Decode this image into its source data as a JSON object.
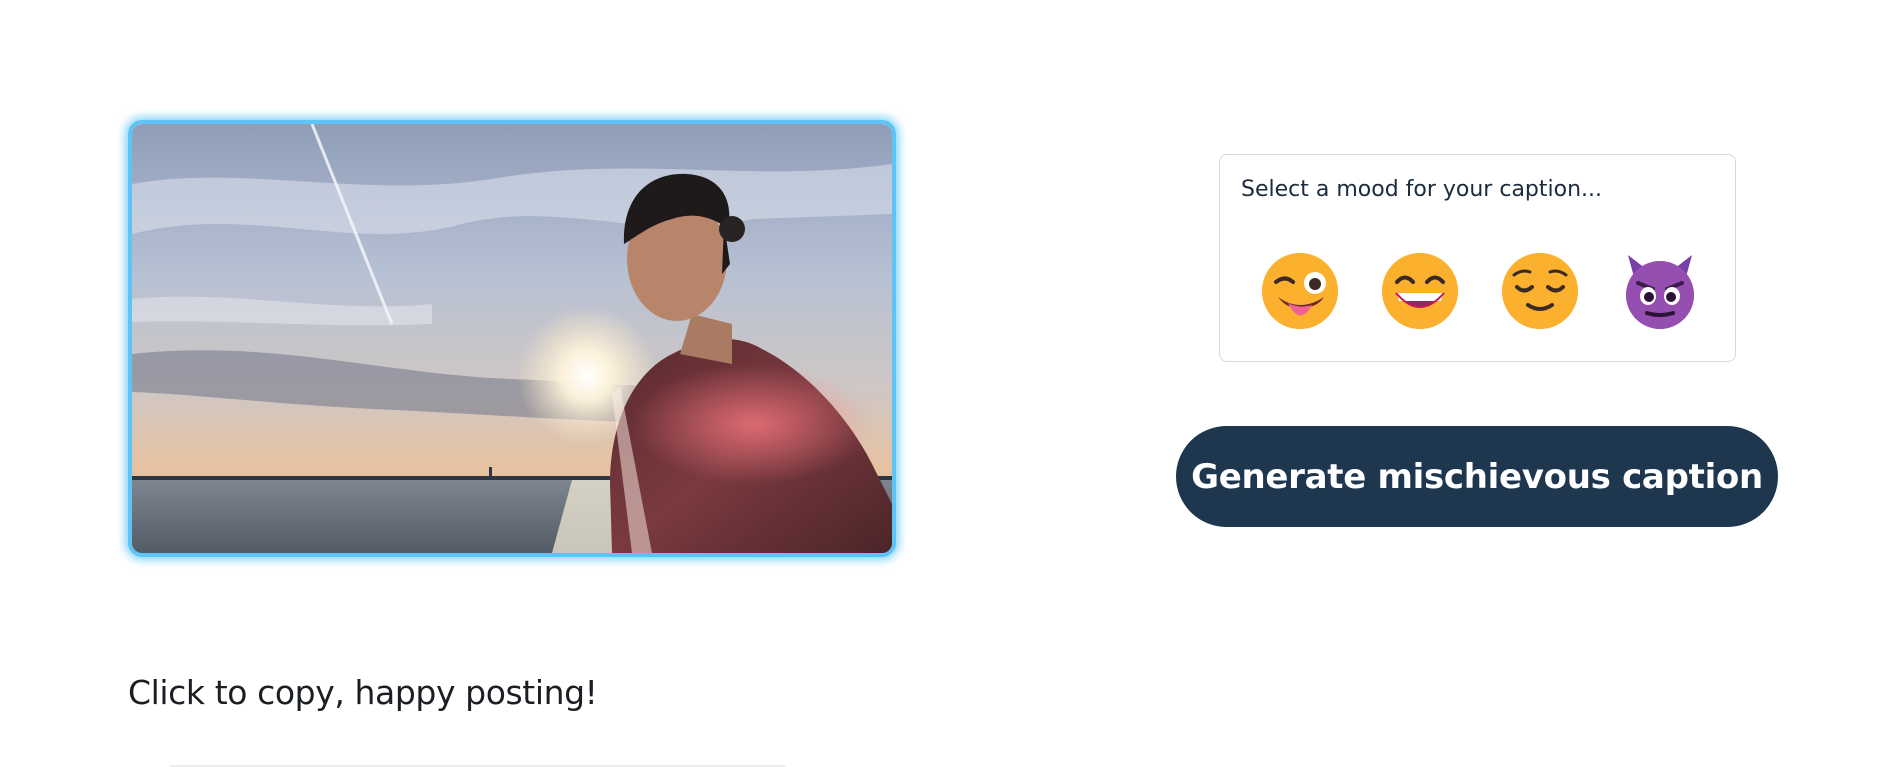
{
  "photo": {
    "alt": "",
    "accent_color": "#5cc4f7"
  },
  "mood_selector": {
    "prompt": "Select a mood for your caption...",
    "options": [
      {
        "icon": "winking-face-with-tongue-icon"
      },
      {
        "icon": "grinning-face-icon"
      },
      {
        "icon": "relieved-face-icon"
      },
      {
        "icon": "smiling-face-with-horns-icon"
      }
    ]
  },
  "actions": {
    "generate_label": "Generate mischievous caption",
    "button_color": "#1e374f"
  },
  "footer": {
    "copy_hint": "Click to copy, happy posting!"
  }
}
